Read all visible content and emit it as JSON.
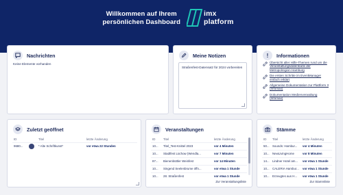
{
  "hero": {
    "line1": "Willkommen auf Ihrem",
    "line2": "persönlichen Dashboard",
    "brand_line1": "imx",
    "brand_line2": "platform"
  },
  "nachrichten": {
    "title": "Nachrichten",
    "empty": "Keine Elemente vorhanden"
  },
  "notizen": {
    "title": "Meine Notizen",
    "text": "Straßenfest-Datensatz für 2024 vorbereiten"
  },
  "informationen": {
    "title": "Informationen",
    "items": [
      "Übersicht aller Hilfe-Themen rund um die Veranstaltungsdatenbank der Metropolregion Hamburg",
      "Die ersten Schritte im EventManager einfach erklärt",
      "Allgemeine Dokumentation zur Plattform 3 (Infomax)",
      "Dokumentation Medienverwaltung (Infomax)"
    ]
  },
  "zuletzt": {
    "title": "Zuletzt geöffnet",
    "columns": [
      "ID",
      "",
      "Titel",
      "letzte Änderung"
    ],
    "rows": [
      {
        "id": "9680...",
        "title": "* Alte Schriftkunst*",
        "ago": "vor etwa 22 Stunden"
      }
    ]
  },
  "veranstaltungen": {
    "title": "Veranstaltungen",
    "columns": [
      "ID",
      "Titel",
      "letzte Änderung"
    ],
    "rows": [
      {
        "id": "10...",
        "title": "Titel_Test-Knittel 2023",
        "ago": "vor 4 Minuten"
      },
      {
        "id": "10...",
        "title": "Stadtfest Lüchow (Wendla...",
        "ago": "vor 7 Minuten"
      },
      {
        "id": "87...",
        "title": "Bienenbüttler Weinfest",
        "ago": "vor 14 Minuten"
      },
      {
        "id": "10...",
        "title": "Singend Seelenbrume öffn...",
        "ago": "vor etwa 1 Stunde"
      },
      {
        "id": "10...",
        "title": "28. Straßenfest",
        "ago": "vor etwa 1 Stunde"
      }
    ],
    "footer": "Zur Veranstaltungsliste"
  },
  "staemme": {
    "title": "Stämme",
    "columns": [
      "ID",
      "Titel",
      "letzte Änderung"
    ],
    "rows": [
      {
        "id": "50...",
        "title": "Sounds: Hambur...",
        "ago": "vor 4 Minuten"
      },
      {
        "id": "10...",
        "title": "NewLivingHome",
        "ago": "vor 8 Minuten"
      },
      {
        "id": "14...",
        "title": "Lindner Hotel am...",
        "ago": "vor etwa 1 Stunde"
      },
      {
        "id": "10...",
        "title": "CALERIA Hambur...",
        "ago": "vor etwa 1 Stunde"
      },
      {
        "id": "10...",
        "title": "Erzeugtes aus H...",
        "ago": "vor etwa 1 Stunde"
      }
    ],
    "footer": "Zur Stammliste"
  }
}
